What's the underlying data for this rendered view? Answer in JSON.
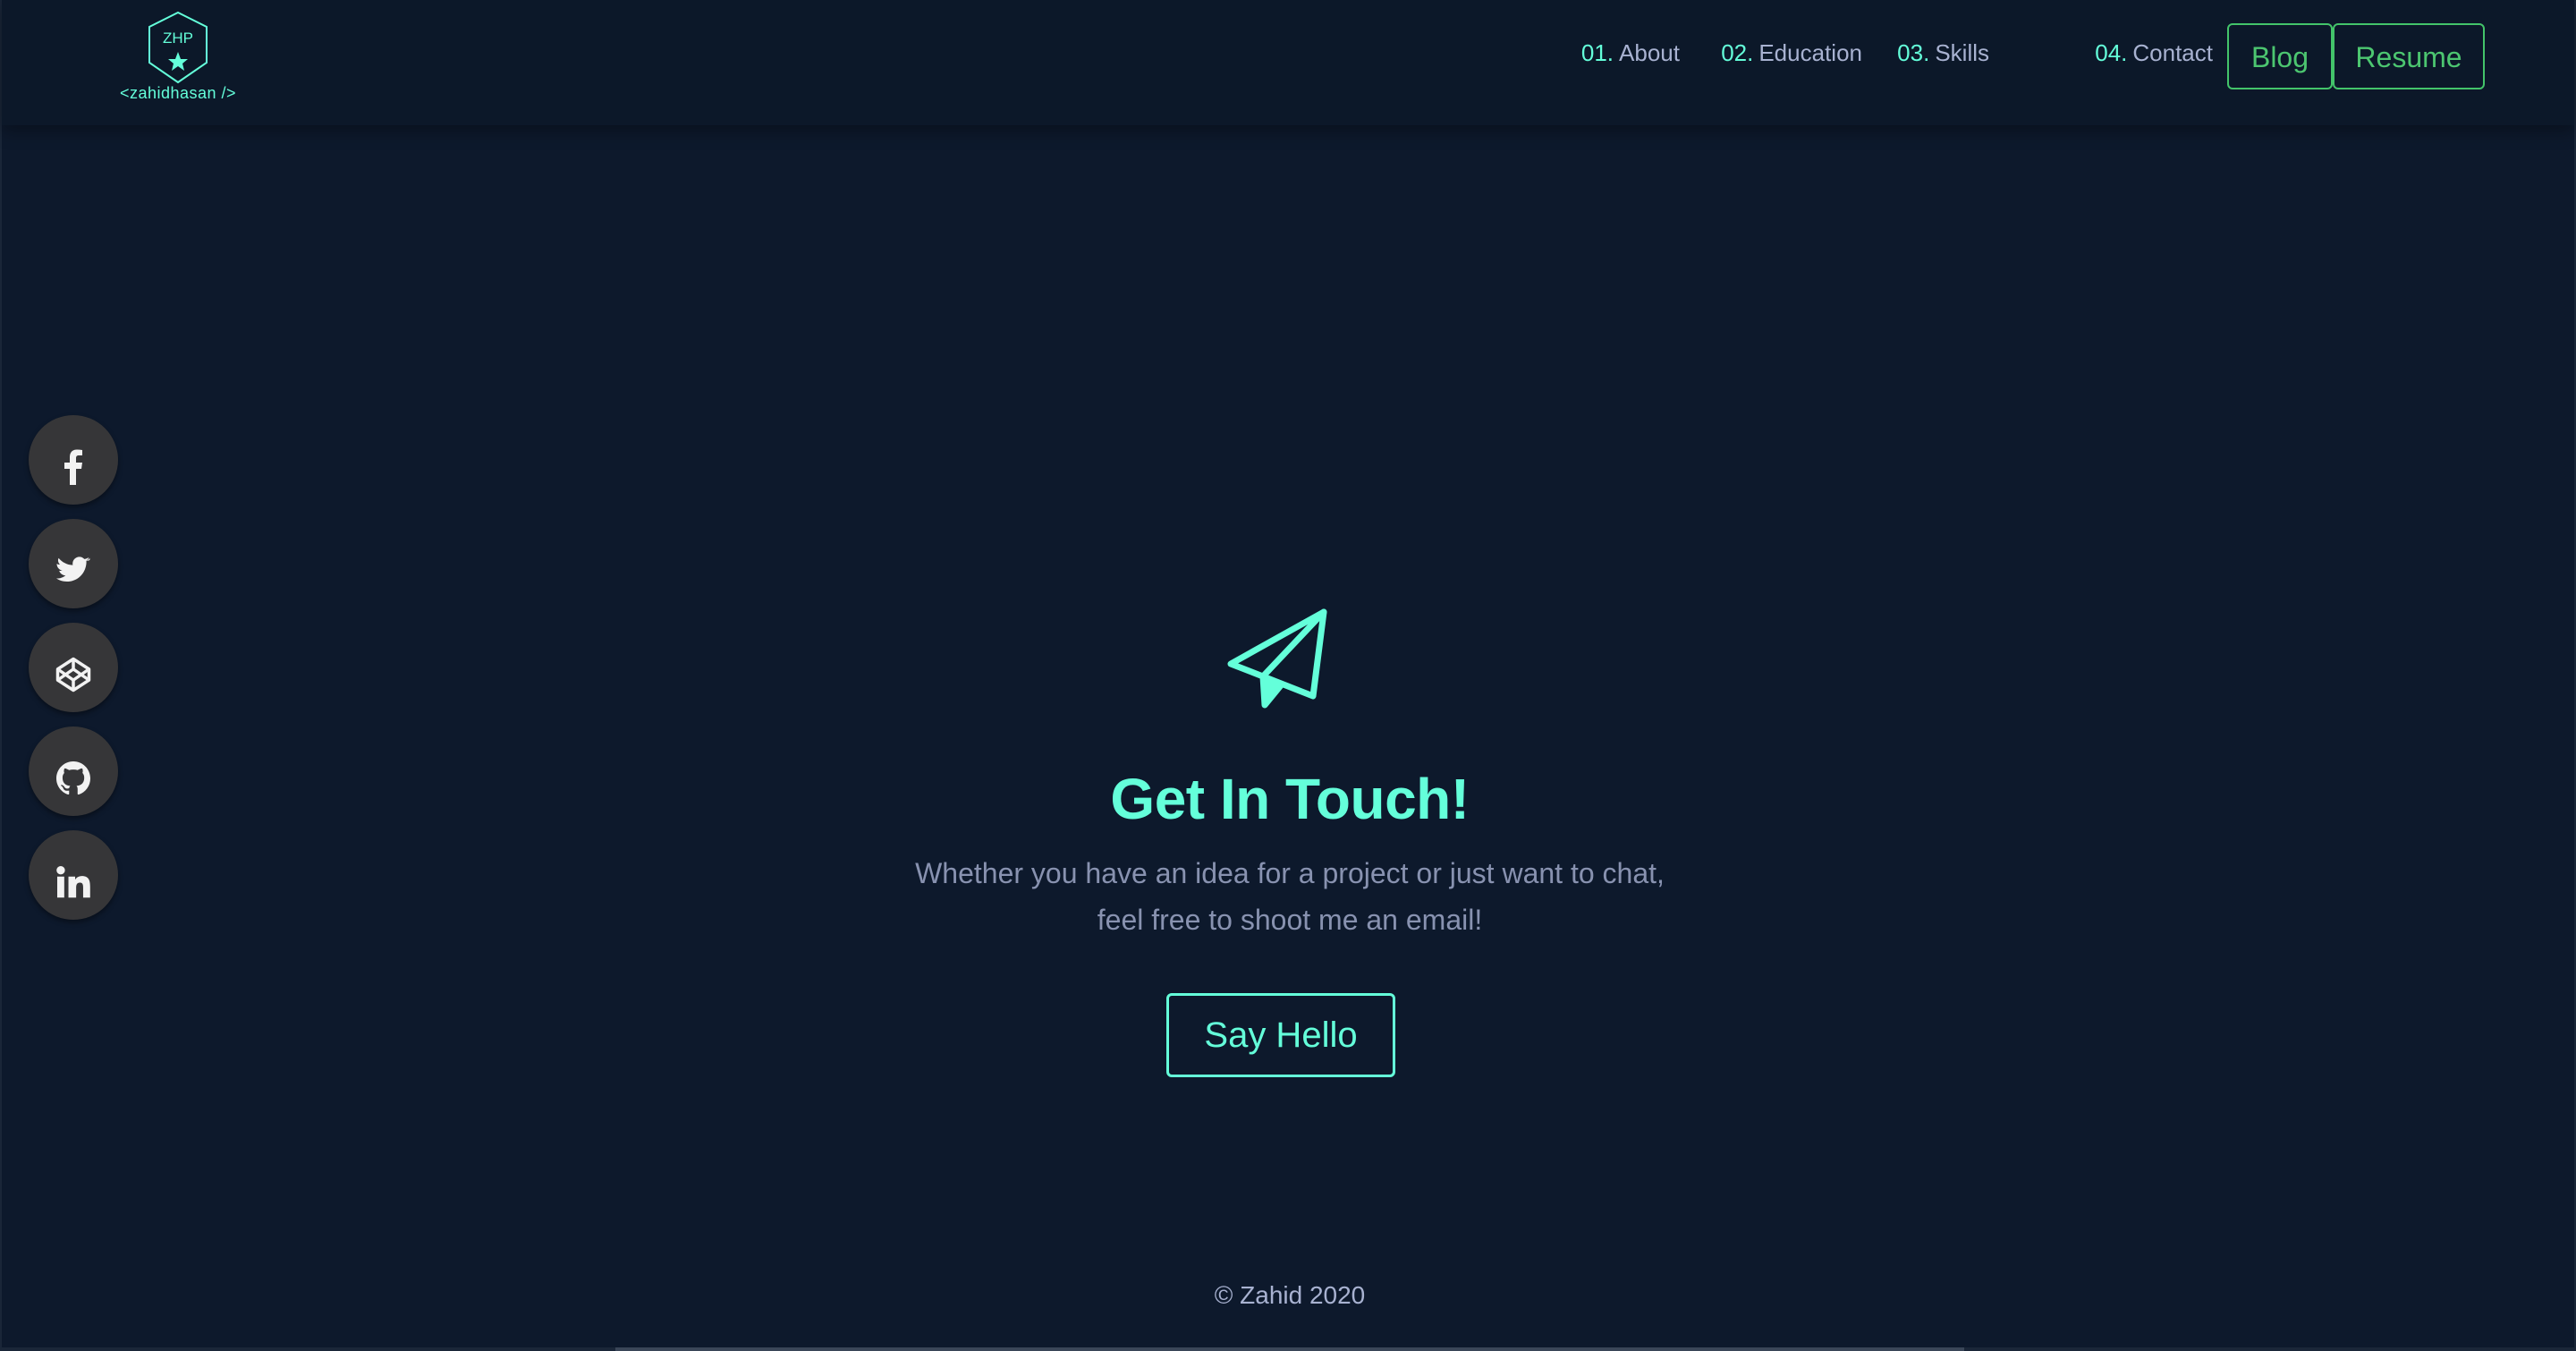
{
  "logo": {
    "initials": "ZHP",
    "subtitle": "<zahidhasan />",
    "icon": "shield-star-icon"
  },
  "nav": {
    "items": [
      {
        "num": "01.",
        "label": "About"
      },
      {
        "num": "02.",
        "label": "Education"
      },
      {
        "num": "03.",
        "label": "Skills"
      },
      {
        "num": "04.",
        "label": "Contact"
      }
    ],
    "blog_label": "Blog",
    "resume_label": "Resume"
  },
  "social": [
    {
      "icon": "facebook-icon"
    },
    {
      "icon": "twitter-icon"
    },
    {
      "icon": "codepen-icon"
    },
    {
      "icon": "github-icon"
    },
    {
      "icon": "linkedin-icon"
    }
  ],
  "contact": {
    "icon": "paper-plane-icon",
    "title": "Get In Touch!",
    "line1": "Whether you have an idea for a project or just want to chat,",
    "line2": "feel free to shoot me an email!",
    "button_label": "Say Hello"
  },
  "footer": {
    "text": "© Zahid 2020"
  },
  "colors": {
    "background": "#0d192c",
    "accent": "#64ffda",
    "green": "#43c46a",
    "text": "#8892b0",
    "social_bg": "#363638"
  }
}
